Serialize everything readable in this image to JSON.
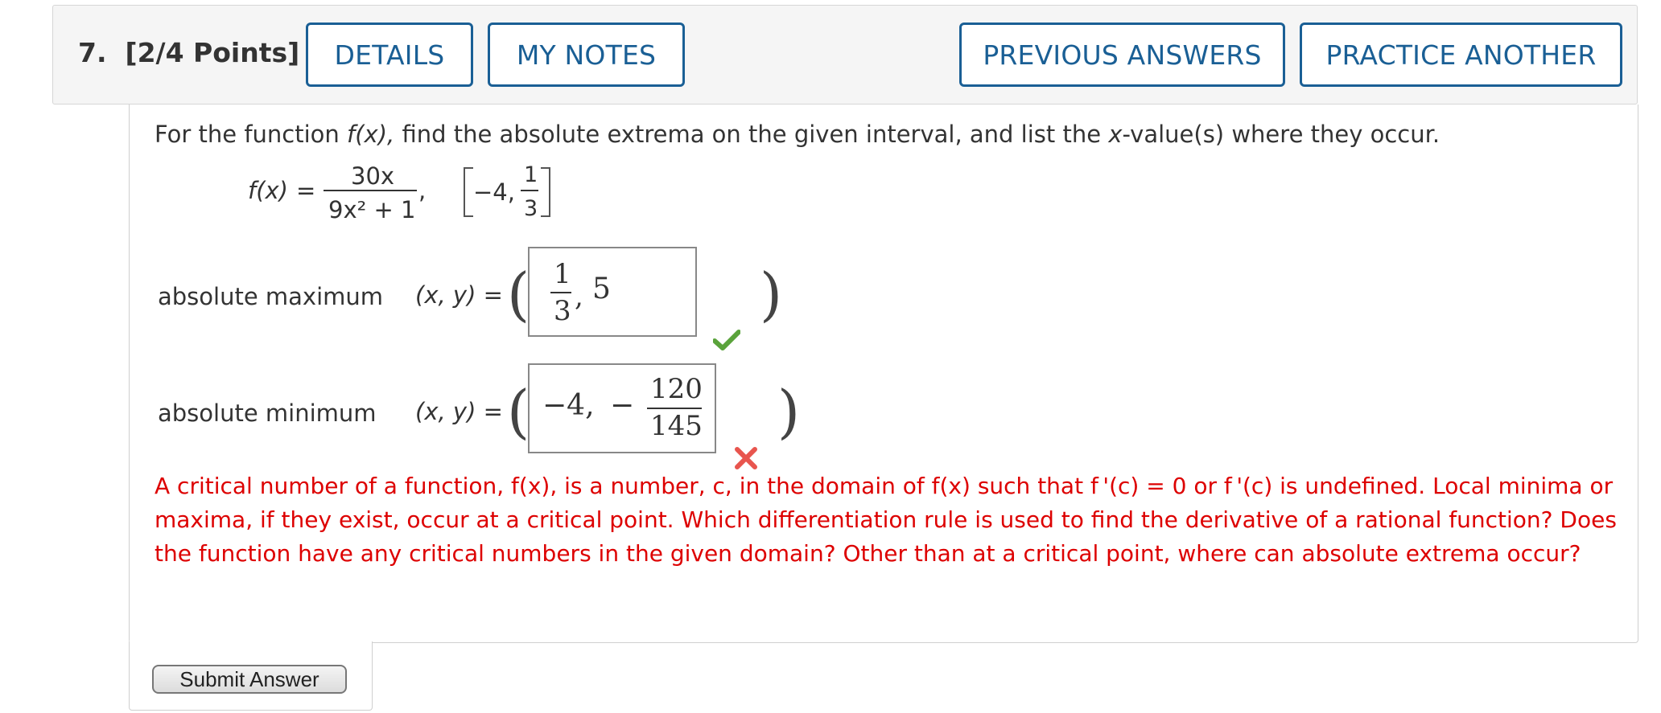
{
  "question": {
    "number": "7.",
    "points": "[2/4 Points]"
  },
  "header_buttons": {
    "details": "DETAILS",
    "my_notes": "MY NOTES",
    "previous_answers": "PREVIOUS ANSWERS",
    "practice_another": "PRACTICE ANOTHER"
  },
  "prompt": {
    "part1": "For the function ",
    "fx": "f(x),",
    "part2": " find the absolute extrema on the given interval, and list the ",
    "xvar": "x",
    "part3": "-value(s) where they occur."
  },
  "function": {
    "lhs": "f(x)",
    "equals": "=",
    "numerator": "30x",
    "denominator": "9x² + 1",
    "comma": ",",
    "interval_left": "−4,",
    "interval_num": "1",
    "interval_den": "3"
  },
  "rows": {
    "max": {
      "label": "absolute maximum",
      "xy": "(x, y) =",
      "answer_num": "1",
      "answer_den": "3",
      "answer_sep": ",",
      "answer_y": "5",
      "status": "correct"
    },
    "min": {
      "label": "absolute minimum",
      "xy": "(x, y) =",
      "answer_x": "−4,",
      "answer_minus": "−",
      "answer_num": "120",
      "answer_den": "145",
      "status": "incorrect"
    }
  },
  "feedback": {
    "text": "A critical number of a function, f(x), is a number, c, in the domain of f(x) such that  f '(c) = 0  or  f '(c)  is undefined. Local minima or maxima, if they exist, occur at a critical point. Which differentiation rule is used to find the derivative of a rational function? Does the function have any critical numbers in the given domain? Other than at a critical point, where can absolute extrema occur?"
  },
  "submit": {
    "label": "Submit Answer"
  },
  "colors": {
    "button_blue": "#1a5f95",
    "error_red": "#dd0000",
    "check_green": "#5aa33b"
  }
}
